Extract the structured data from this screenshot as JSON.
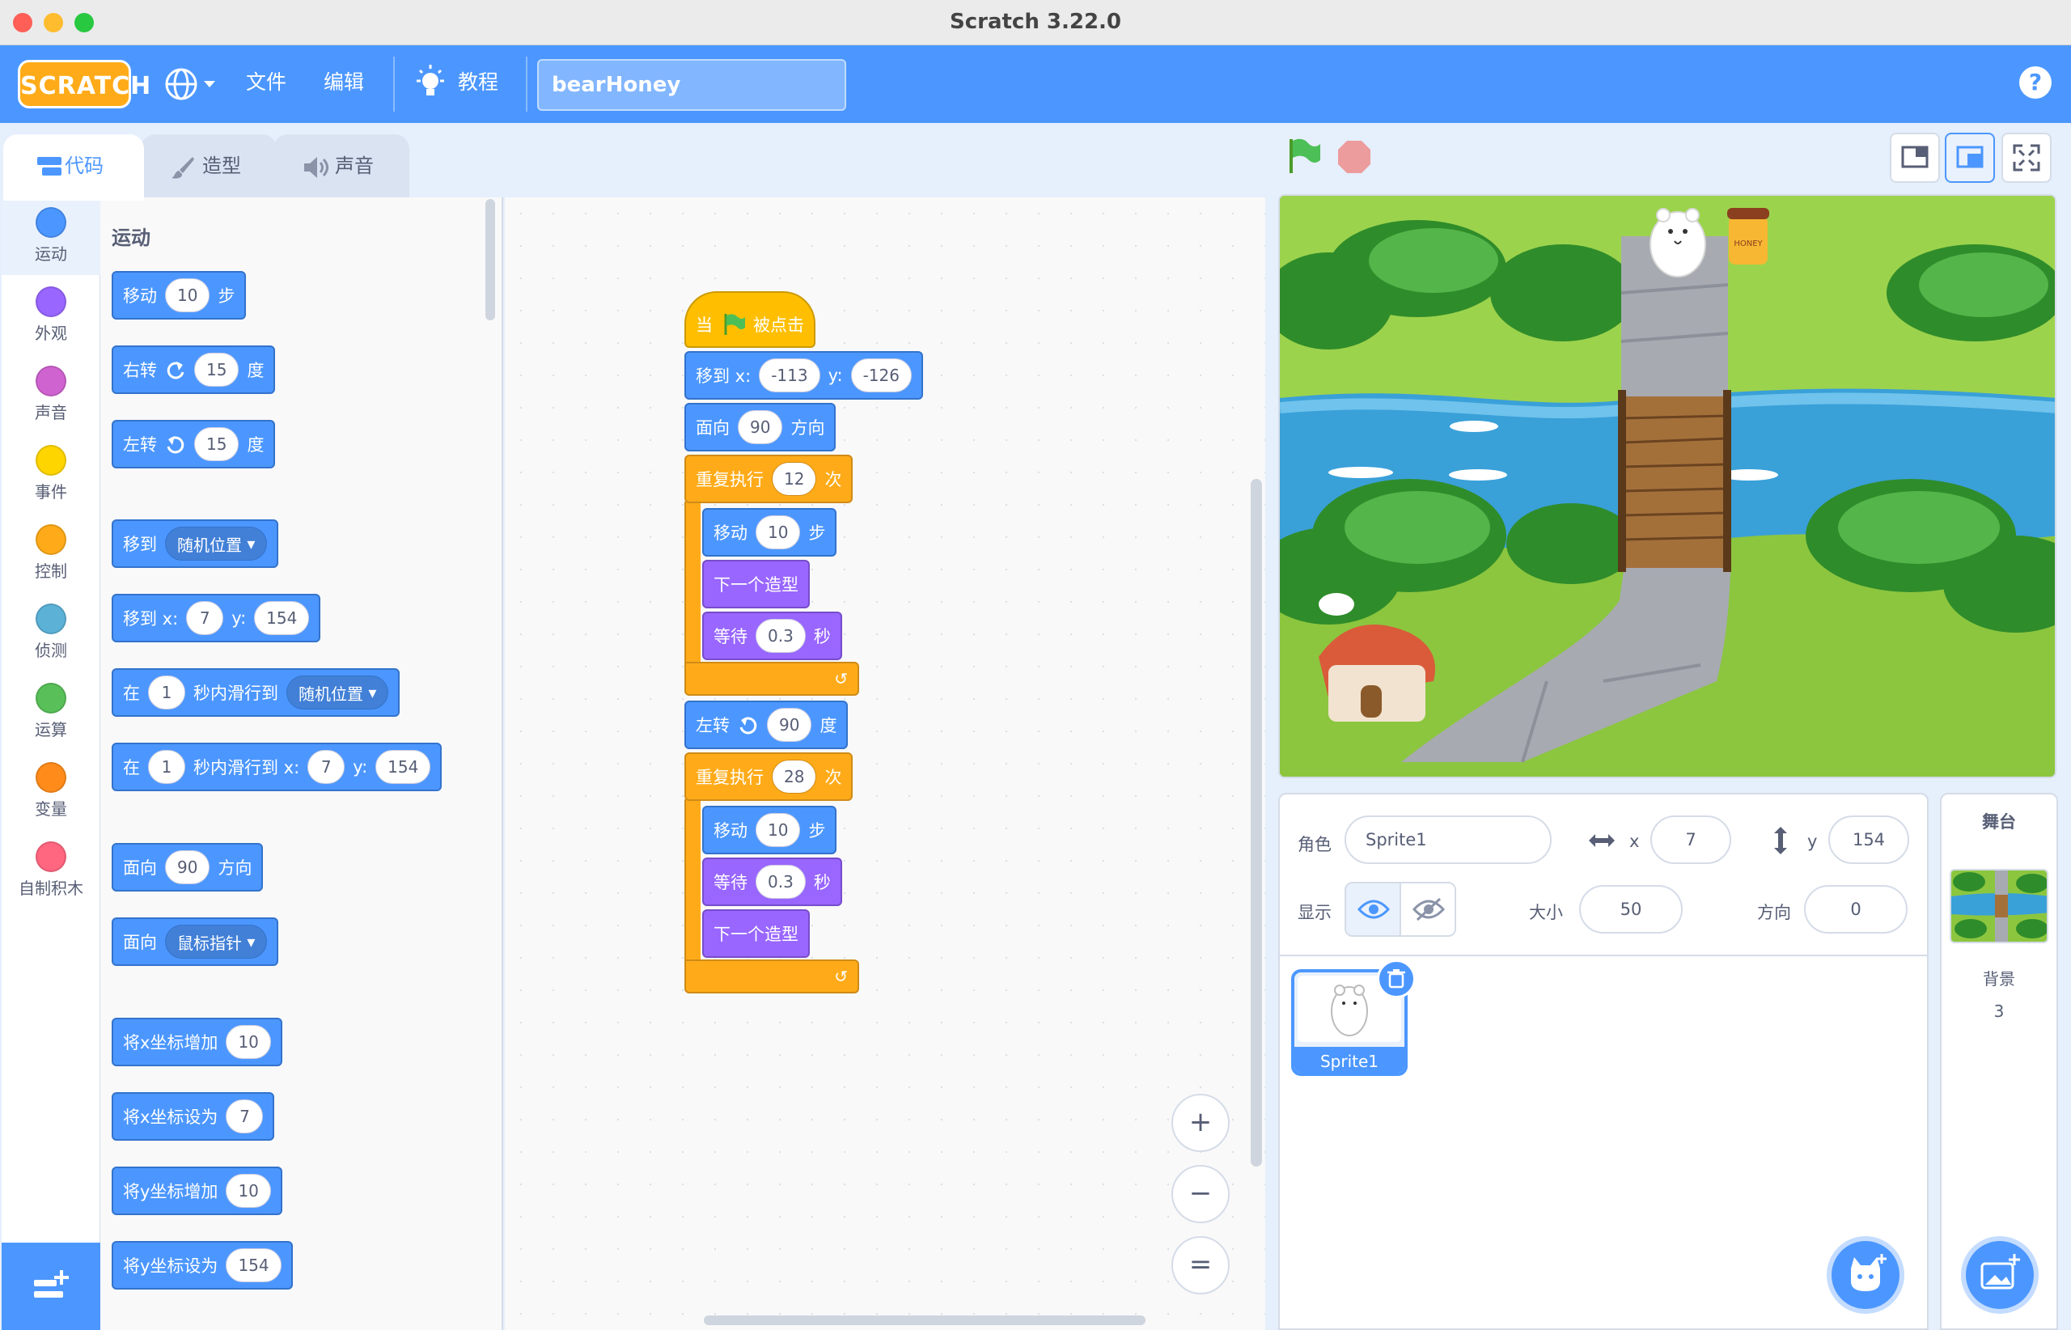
{
  "window": {
    "title": "Scratch 3.22.0"
  },
  "menubar": {
    "logo": "SCRATCH",
    "file": "文件",
    "edit": "编辑",
    "tutorials": "教程",
    "project_title": "bearHoney",
    "help": "?"
  },
  "tabs": {
    "code": "代码",
    "costumes": "造型",
    "sounds": "声音"
  },
  "categories": [
    {
      "label": "运动",
      "color": "#4c97ff"
    },
    {
      "label": "外观",
      "color": "#9966ff"
    },
    {
      "label": "声音",
      "color": "#cf63cf"
    },
    {
      "label": "事件",
      "color": "#ffd500"
    },
    {
      "label": "控制",
      "color": "#ffab19"
    },
    {
      "label": "侦测",
      "color": "#5cb1d6"
    },
    {
      "label": "运算",
      "color": "#59c059"
    },
    {
      "label": "变量",
      "color": "#ff8c1a"
    },
    {
      "label": "自制积木",
      "color": "#ff6680"
    }
  ],
  "palette": {
    "heading": "运动",
    "move": {
      "a": "移动",
      "n": "10",
      "b": "步"
    },
    "turn_right": {
      "a": "右转",
      "n": "15",
      "b": "度"
    },
    "turn_left": {
      "a": "左转",
      "n": "15",
      "b": "度"
    },
    "goto": {
      "a": "移到",
      "drop": "随机位置"
    },
    "goto_xy": {
      "a": "移到 x:",
      "x": "7",
      "y_label": "y:",
      "y": "154"
    },
    "glide": {
      "a": "在",
      "n": "1",
      "b": "秒内滑行到",
      "drop": "随机位置"
    },
    "glide_xy": {
      "a": "在",
      "n": "1",
      "b": "秒内滑行到 x:",
      "x": "7",
      "y_label": "y:",
      "y": "154"
    },
    "point_dir": {
      "a": "面向",
      "n": "90",
      "b": "方向"
    },
    "point_towards": {
      "a": "面向",
      "drop": "鼠标指针"
    },
    "change_x": {
      "a": "将x坐标增加",
      "n": "10"
    },
    "set_x": {
      "a": "将x坐标设为",
      "n": "7"
    },
    "change_y": {
      "a": "将y坐标增加",
      "n": "10"
    },
    "set_y": {
      "a": "将y坐标设为",
      "n": "154"
    }
  },
  "script": {
    "hat": {
      "a": "当",
      "b": "被点击"
    },
    "goto": {
      "a": "移到 x:",
      "x": "-113",
      "y_label": "y:",
      "y": "-126"
    },
    "point": {
      "a": "面向",
      "n": "90",
      "b": "方向"
    },
    "repeat1": {
      "a": "重复执行",
      "n": "12",
      "b": "次"
    },
    "move1": {
      "a": "移动",
      "n": "10",
      "b": "步"
    },
    "costume1": "下一个造型",
    "wait1": {
      "a": "等待",
      "n": "0.3",
      "b": "秒"
    },
    "turn": {
      "a": "左转",
      "n": "90",
      "b": "度"
    },
    "repeat2": {
      "a": "重复执行",
      "n": "28",
      "b": "次"
    },
    "move2": {
      "a": "移动",
      "n": "10",
      "b": "步"
    },
    "wait2": {
      "a": "等待",
      "n": "0.3",
      "b": "秒"
    },
    "costume2": "下一个造型"
  },
  "zoom": {
    "in": "+",
    "out": "−",
    "reset": "="
  },
  "sprite_info": {
    "sprite_label": "角色",
    "sprite_name": "Sprite1",
    "x_label": "x",
    "x_value": "7",
    "y_label": "y",
    "y_value": "154",
    "show_label": "显示",
    "size_label": "大小",
    "size_value": "50",
    "direction_label": "方向",
    "direction_value": "0"
  },
  "sprites": [
    {
      "name": "Sprite1"
    }
  ],
  "stage_panel": {
    "title": "舞台",
    "backdrop_label": "背景",
    "backdrop_count": "3"
  },
  "stage": {
    "jar_label": "HONEY"
  }
}
